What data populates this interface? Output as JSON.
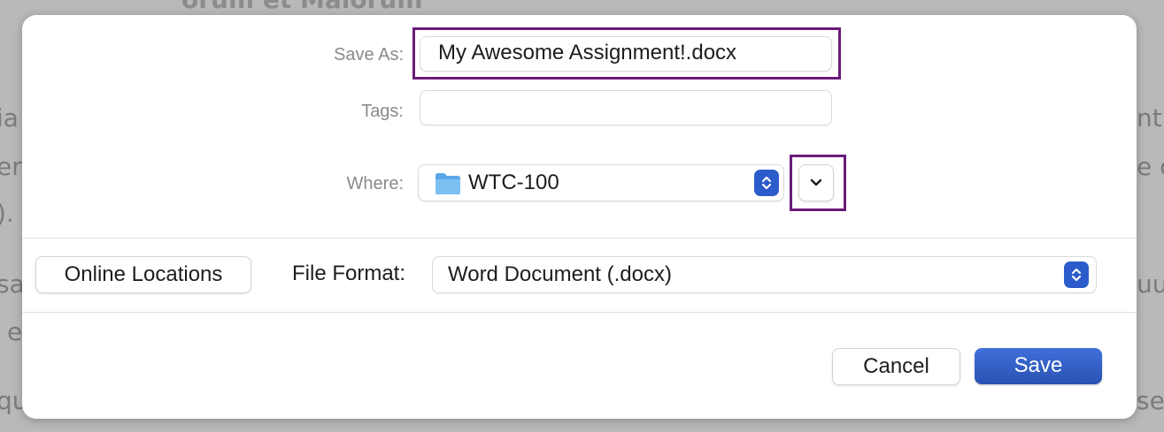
{
  "background_doc": {
    "heading_fragment": "orum et Malorum",
    "left_fragments": [
      "ia",
      "er",
      ").",
      "sa",
      "e",
      "qu"
    ],
    "right_fragments": [
      "nt",
      "e c",
      "uu",
      "se"
    ]
  },
  "dialog": {
    "save_as": {
      "label": "Save As:",
      "value": "My Awesome Assignment!.docx"
    },
    "tags": {
      "label": "Tags:",
      "value": ""
    },
    "where": {
      "label": "Where:",
      "value": "WTC-100",
      "icon": "folder-icon"
    },
    "online_locations_label": "Online Locations",
    "file_format": {
      "label": "File Format:",
      "value": "Word Document (.docx)"
    },
    "cancel_label": "Cancel",
    "save_label": "Save"
  },
  "colors": {
    "highlight": "#6a1b7a",
    "accent": "#2c5ccc",
    "folder": "#6fb5ef"
  }
}
